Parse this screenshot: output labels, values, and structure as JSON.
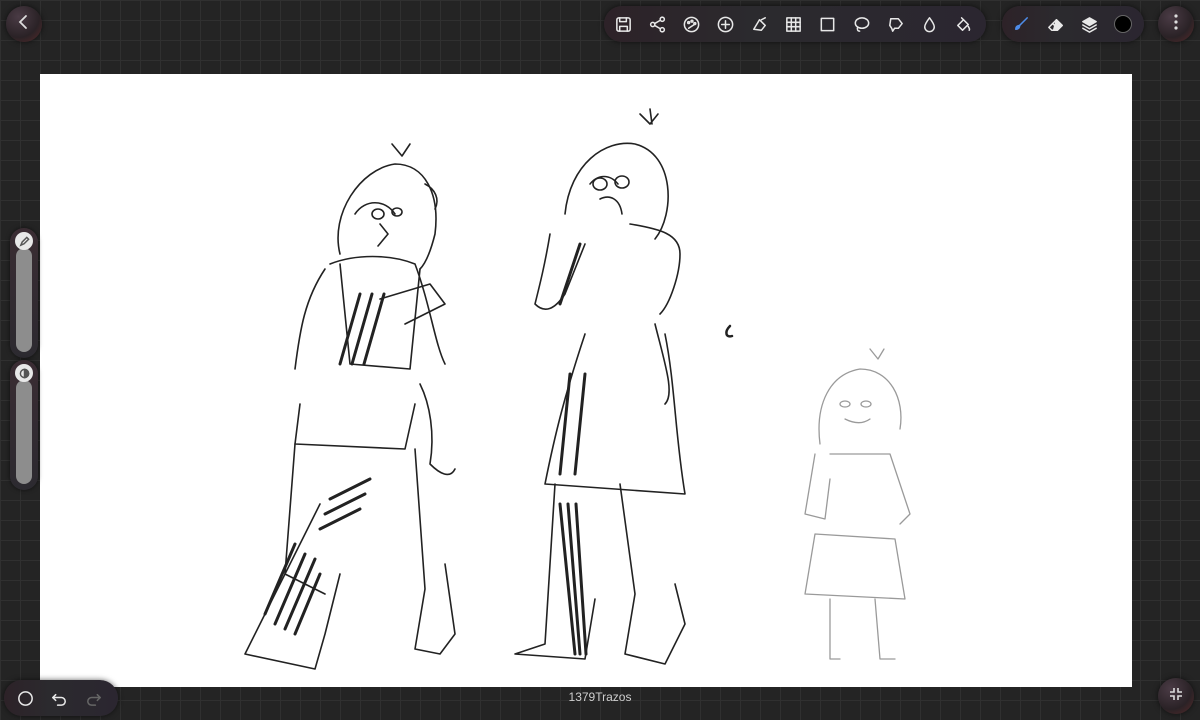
{
  "app": {
    "stroke_count": "1379Trazos"
  },
  "toolbar": {
    "left_group": [
      "save-icon",
      "share-icon",
      "adjustments-icon",
      "add-icon",
      "transform-icon",
      "grid-icon",
      "rectangle-icon",
      "lasso-icon",
      "lasso-polygon-icon",
      "blur-icon",
      "fill-bucket-icon"
    ],
    "right_group": [
      "brush-icon",
      "eraser-icon",
      "layers-icon",
      "color-swatch"
    ],
    "active_tool": "brush-icon",
    "brush_color": "#4d8ce8",
    "current_color": "#000000"
  },
  "side_sliders": {
    "size_level": 0.93,
    "opacity_level": 0.94
  },
  "bottom_controls": [
    "record-icon",
    "undo-icon",
    "redo-icon"
  ],
  "colors": {
    "background": "#242424",
    "canvas": "#ffffff"
  }
}
